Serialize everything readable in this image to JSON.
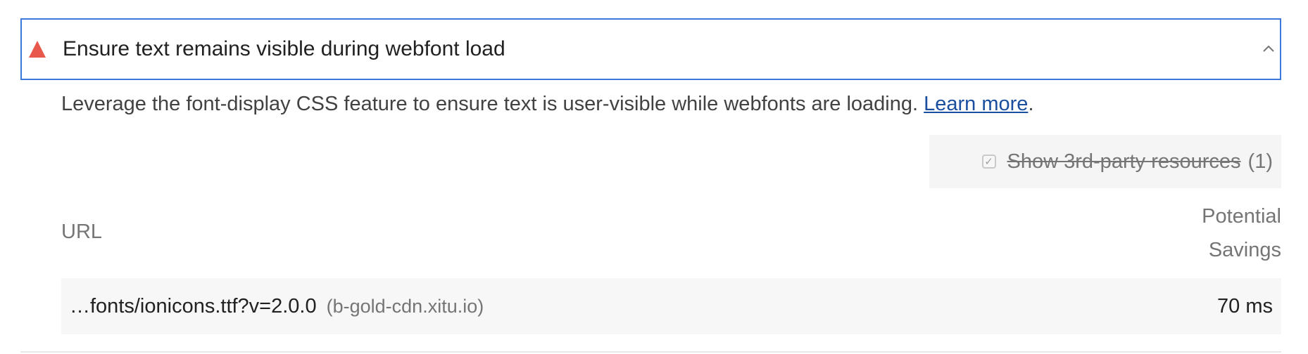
{
  "audit": {
    "title": "Ensure text remains visible during webfont load",
    "status_icon": "fail-triangle-icon",
    "status_color": "#e8584c",
    "expanded_icon": "chevron-up-icon",
    "description": "Leverage the font-display CSS feature to ensure text is user-visible while webfonts are loading.",
    "learn_more_label": "Learn more",
    "description_suffix": "."
  },
  "filter": {
    "checked": true,
    "label": "Show 3rd-party resources",
    "count": "(1)"
  },
  "table": {
    "headers": {
      "url": "URL",
      "savings_line1": "Potential",
      "savings_line2": "Savings"
    },
    "rows": [
      {
        "url": "…fonts/ionicons.ttf?v=2.0.0",
        "host": "(b-gold-cdn.xitu.io)",
        "savings": "70 ms"
      }
    ]
  },
  "colors": {
    "accent_border": "#3c78d8",
    "link": "#1a4fa0"
  }
}
